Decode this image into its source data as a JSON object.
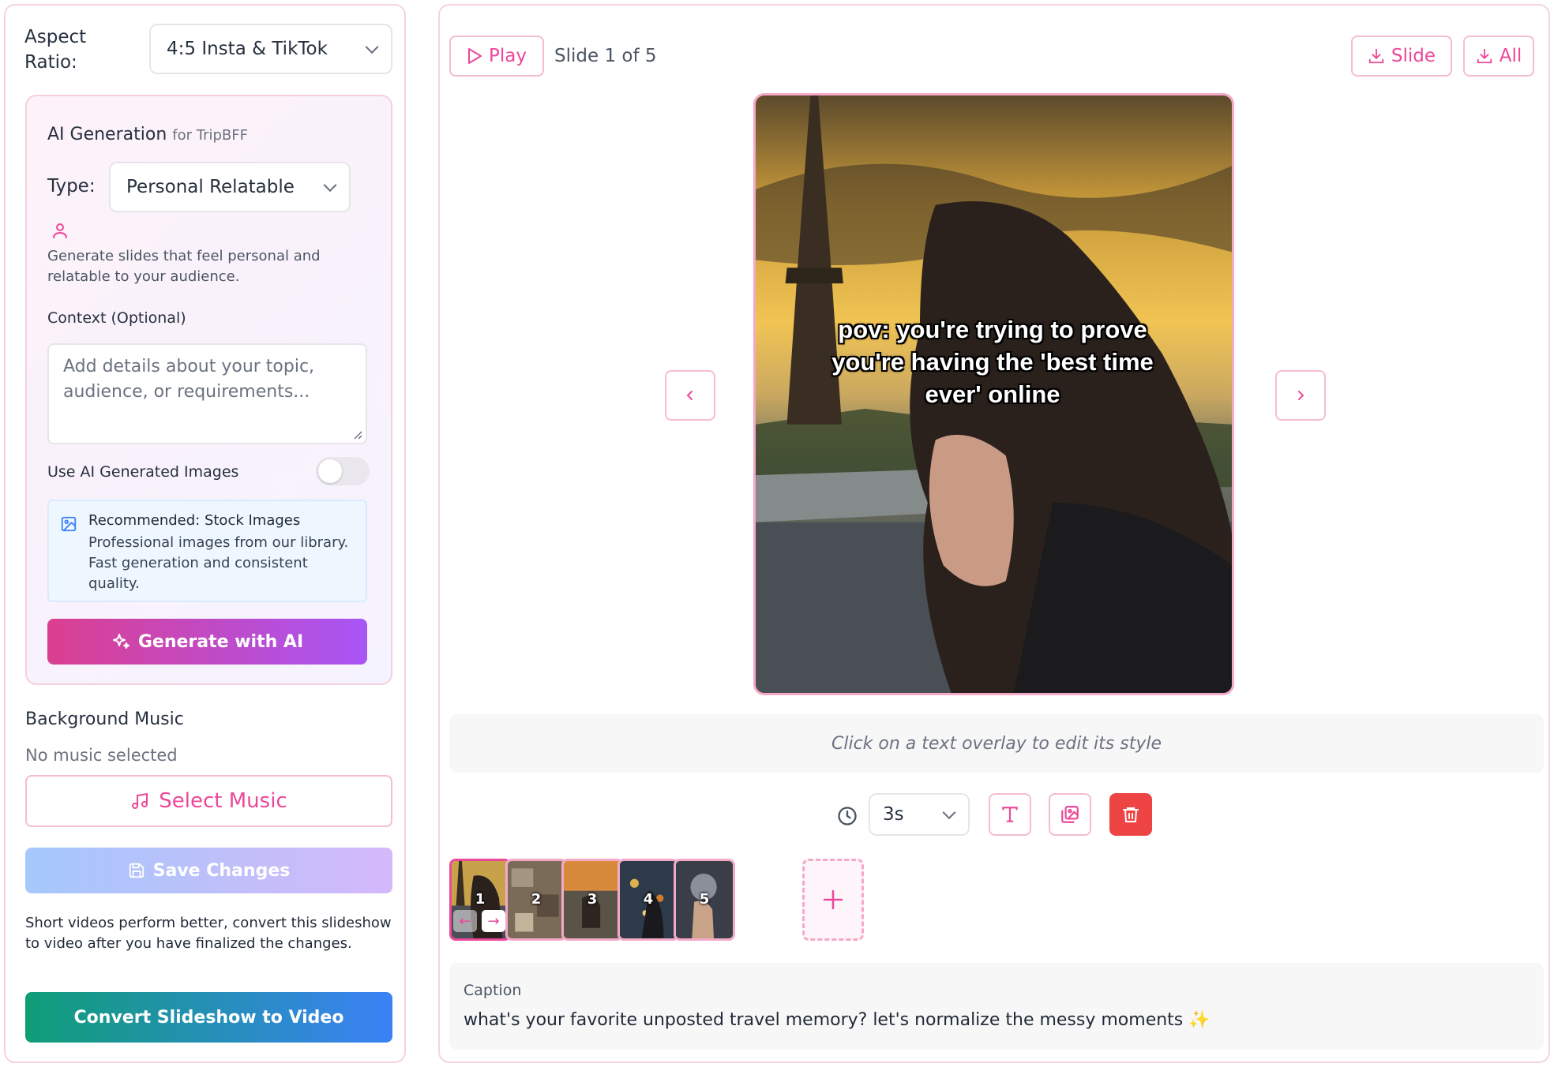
{
  "left": {
    "aspect_label": "Aspect Ratio:",
    "aspect_value": "4:5 Insta & TikTok",
    "ai_card": {
      "title": "AI Generation",
      "subtitle": "for TripBFF",
      "type_label": "Type:",
      "type_value": "Personal Relatable",
      "description": "Generate slides that feel personal and relatable to your audience.",
      "context_label": "Context (Optional)",
      "context_placeholder": "Add details about your topic, audience, or requirements...",
      "ai_images_label": "Use AI Generated Images",
      "ai_images_enabled": false,
      "recommendation_title": "Recommended: Stock Images",
      "recommendation_text": "Professional images from our library. Fast generation and consistent quality.",
      "generate_label": "Generate with AI"
    },
    "music": {
      "title": "Background Music",
      "status": "No music selected",
      "select_label": "Select Music"
    },
    "save_label": "Save Changes",
    "note": "Short videos perform better, convert this slideshow to video after you have finalized the changes.",
    "convert_label": "Convert Slideshow to Video"
  },
  "right": {
    "play_label": "Play",
    "slide_counter": "Slide 1 of 5",
    "download_slide_label": "Slide",
    "download_all_label": "All",
    "overlay_text": "pov: you're trying to prove you're having the 'best time ever' online",
    "hint": "Click on a text overlay to edit its style",
    "duration": "3s",
    "thumbnails": [
      {
        "number": "1",
        "active": true
      },
      {
        "number": "2",
        "active": false
      },
      {
        "number": "3",
        "active": false
      },
      {
        "number": "4",
        "active": false
      },
      {
        "number": "5",
        "active": false
      }
    ],
    "caption_label": "Caption",
    "caption_text": "what's your favorite unposted travel memory? let's normalize the messy moments ✨"
  },
  "colors": {
    "accent": "#ec4899",
    "border_pink": "#f4bcd3",
    "delete": "#ef4444",
    "convert_start": "#0f9d76",
    "convert_end": "#3b82f6"
  },
  "icons": [
    "user-icon",
    "image-icon",
    "sparkles-icon",
    "music-note-icon",
    "save-icon",
    "play-icon",
    "download-icon",
    "chevron-left-icon",
    "chevron-right-icon",
    "clock-icon",
    "text-icon",
    "images-icon",
    "trash-icon",
    "plus-icon",
    "chevron-down-icon"
  ]
}
